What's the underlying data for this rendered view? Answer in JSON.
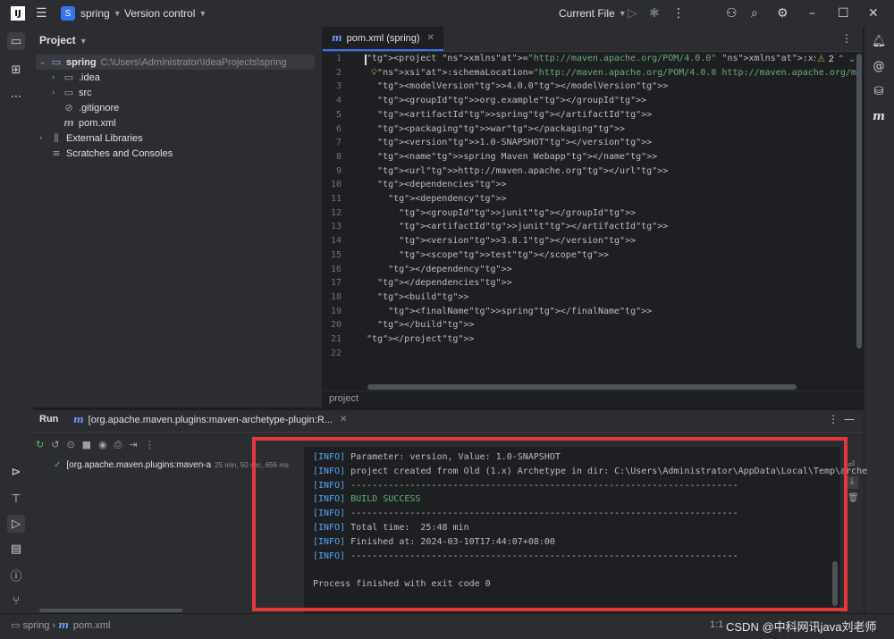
{
  "titlebar": {
    "logo": "IJ",
    "project_initial": "S",
    "project_name": "spring",
    "vcs": "Version control",
    "run_config": "Current File"
  },
  "project_panel": {
    "title": "Project",
    "tree": [
      {
        "name": "spring",
        "path": "C:\\Users\\Administrator\\IdeaProjects\\spring",
        "icon": "folder-icon"
      },
      {
        "name": ".idea",
        "icon": "folder-icon"
      },
      {
        "name": "src",
        "icon": "folder-icon"
      },
      {
        "name": ".gitignore",
        "icon": "gitignore-icon"
      },
      {
        "name": "pom.xml",
        "icon": "maven-icon"
      },
      {
        "name": "External Libraries",
        "icon": "library-icon"
      },
      {
        "name": "Scratches and Consoles",
        "icon": "scratches-icon"
      }
    ]
  },
  "editor": {
    "tab_label": "pom.xml (spring)",
    "warning_count": "2",
    "breadcrumb": "project",
    "line_numbers": [
      "1",
      "2",
      "3",
      "4",
      "5",
      "6",
      "7",
      "8",
      "9",
      "10",
      "11",
      "12",
      "13",
      "14",
      "15",
      "16",
      "17",
      "18",
      "19",
      "20",
      "21",
      "22"
    ],
    "lines": [
      "<project xmlns=\"http://maven.apache.org/POM/4.0.0\" xmlns:xsi=\"http://www.w3.org/2001/XM",
      "  xsi:schemaLocation=\"http://maven.apache.org/POM/4.0.0 http://maven.apache.org/maven-v4_0_0.xsd",
      "  <modelVersion>4.0.0</modelVersion>",
      "  <groupId>org.example</groupId>",
      "  <artifactId>spring</artifactId>",
      "  <packaging>war</packaging>",
      "  <version>1.0-SNAPSHOT</version>",
      "  <name>spring Maven Webapp</name>",
      "  <url>http://maven.apache.org</url>",
      "  <dependencies>",
      "    <dependency>",
      "      <groupId>junit</groupId>",
      "      <artifactId>junit</artifactId>",
      "      <version>3.8.1</version>",
      "      <scope>test</scope>",
      "    </dependency>",
      "  </dependencies>",
      "  <build>",
      "    <finalName>spring</finalName>",
      "  </build>",
      "</project>",
      ""
    ]
  },
  "run_panel": {
    "title": "Run",
    "tab_label": "[org.apache.maven.plugins:maven-archetype-plugin:R...",
    "tree_item": "[org.apache.maven.plugins:maven-a",
    "tree_item_time": "25 min, 50 sec, 656 ms",
    "console": [
      {
        "tag": "[INFO]",
        "text": " Parameter: version, Value: 1.0-SNAPSHOT"
      },
      {
        "tag": "[INFO]",
        "text": " project created from Old (1.x) Archetype in dir: C:\\Users\\Administrator\\AppData\\Local\\Temp\\arche"
      },
      {
        "tag": "[INFO]",
        "text": " ------------------------------------------------------------------------"
      },
      {
        "tag": "[INFO]",
        "text": " BUILD SUCCESS"
      },
      {
        "tag": "[INFO]",
        "text": " ------------------------------------------------------------------------"
      },
      {
        "tag": "[INFO]",
        "text": " Total time:  25:48 min"
      },
      {
        "tag": "[INFO]",
        "text": " Finished at: 2024-03-10T17:44:07+08:00"
      },
      {
        "tag": "[INFO]",
        "text": " ------------------------------------------------------------------------"
      },
      {
        "tag": "",
        "text": ""
      },
      {
        "tag": "",
        "text": "Process finished with exit code 0"
      }
    ]
  },
  "statusbar": {
    "crumb1": "spring",
    "crumb2": "pom.xml",
    "position": "1:1",
    "watermark": "CSDN @中科网讯java刘老师"
  },
  "colors": {
    "accent": "#3574f0",
    "highlight_box": "#e5383b",
    "success": "#5fb865",
    "info": "#56a8f5"
  }
}
